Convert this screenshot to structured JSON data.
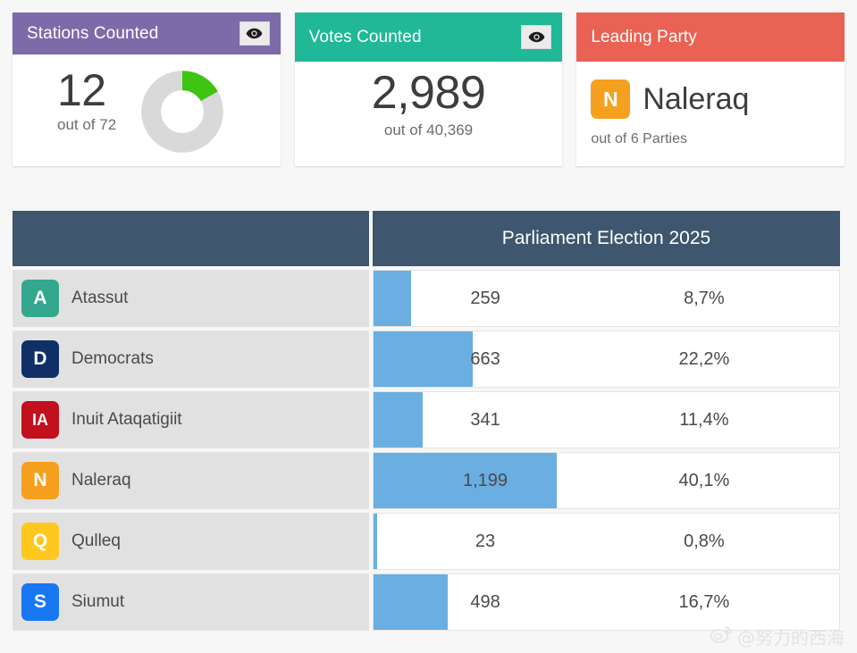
{
  "cards": [
    {
      "title": "Stations Counted",
      "header_color": "#7d6aa8",
      "eye_icon": "eye-icon",
      "value": "12",
      "sub": "out of 72",
      "donut": {
        "percent": 16.7,
        "fill_color": "#3ec413",
        "track_color": "#d9d9d9"
      }
    },
    {
      "title": "Votes Counted",
      "header_color": "#20b896",
      "eye_icon": "eye-icon",
      "value": "2,989",
      "sub": "out of 40,369"
    },
    {
      "title": "Leading Party",
      "header_color": "#e96253",
      "badge": "N",
      "badge_color": "#f5a01e",
      "value": "Naleraq",
      "sub": "out of 6 Parties"
    }
  ],
  "table": {
    "header_left": "",
    "header_right": "Parliament Election 2025",
    "header_color": "#3e566e",
    "bar_color": "#6aaee2"
  },
  "chart_data": {
    "type": "bar",
    "title": "Parliament Election 2025",
    "xlabel": "",
    "ylabel": "",
    "categories": [
      "Atassut",
      "Democrats",
      "Inuit Ataqatigiit",
      "Naleraq",
      "Qulleq",
      "Siumut"
    ],
    "values": [
      259,
      663,
      341,
      1199,
      23,
      498
    ],
    "value_labels": [
      "259",
      "663",
      "341",
      "1,199",
      "23",
      "498"
    ],
    "percent_labels": [
      "8,7%",
      "22,2%",
      "11,4%",
      "40,1%",
      "0,8%",
      "16,7%"
    ],
    "percents": [
      8.7,
      22.2,
      11.4,
      40.1,
      0.8,
      16.7
    ],
    "bar_fraction_of_track": [
      8.1,
      21.3,
      10.6,
      39.4,
      0.8,
      16.0
    ],
    "badges": [
      "A",
      "D",
      "IA",
      "N",
      "Q",
      "S"
    ],
    "badge_colors": [
      "#34a78f",
      "#102f66",
      "#c2101c",
      "#f5a01e",
      "#ffc81e",
      "#1877f2"
    ],
    "total_votes": 2989,
    "xlim": [
      0,
      3000
    ],
    "grid": false,
    "legend": "none"
  },
  "watermark": {
    "handle": "@努力的西海",
    "logo": "weibo-logo-icon"
  }
}
